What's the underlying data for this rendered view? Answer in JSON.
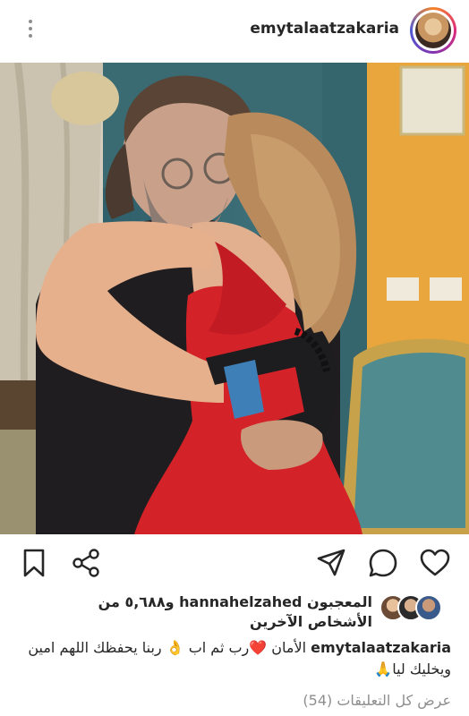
{
  "header": {
    "username": "emytalaatzakaria",
    "more_icon": "more-vertical-icon"
  },
  "photo": {
    "alt_subject": "post-photo"
  },
  "actions": {
    "icons": [
      "bookmark-icon",
      "share-icon",
      "direct-send-icon",
      "comment-icon",
      "heart-icon"
    ]
  },
  "likes": {
    "prefix": "المعجبون",
    "user": "hannahelzahed",
    "suffix": "و٥,٦٨٨ من الأشخاص الآخرين"
  },
  "caption": {
    "user": "emytalaatzakaria",
    "text": "الأمان ❤️رب ثم اب 👌 ربنا يحفظك اللهم امين ويخليك ليا🙏"
  },
  "comments_link": "عرض كل التعليقات (54)"
}
